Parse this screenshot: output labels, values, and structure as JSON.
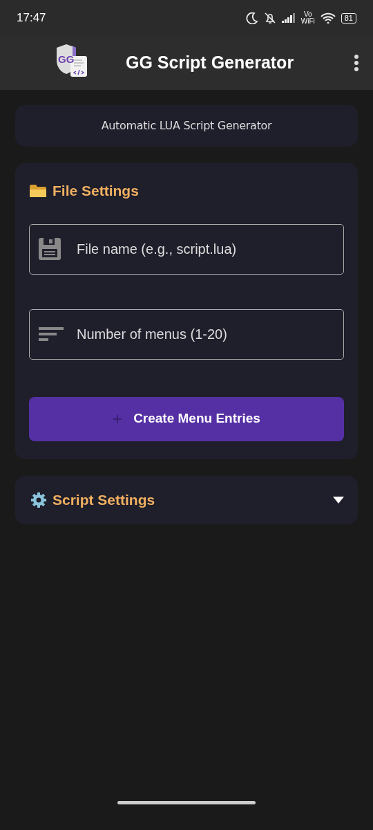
{
  "status_bar": {
    "time": "17:47",
    "volte": [
      "Vo",
      "WiFi"
    ],
    "battery": "81"
  },
  "app_bar": {
    "title": "GG Script Generator",
    "logo_text": "GG"
  },
  "subtitle": "Automatic LUA Script Generator",
  "file_settings": {
    "title": "File Settings",
    "fields": [
      {
        "kind": "file",
        "placeholder": "File name (e.g., script.lua)"
      },
      {
        "kind": "number",
        "placeholder": "Number of menus (1-20)"
      }
    ],
    "button": "Create Menu Entries"
  },
  "script_settings": {
    "title": "Script Settings",
    "expanded": false
  }
}
